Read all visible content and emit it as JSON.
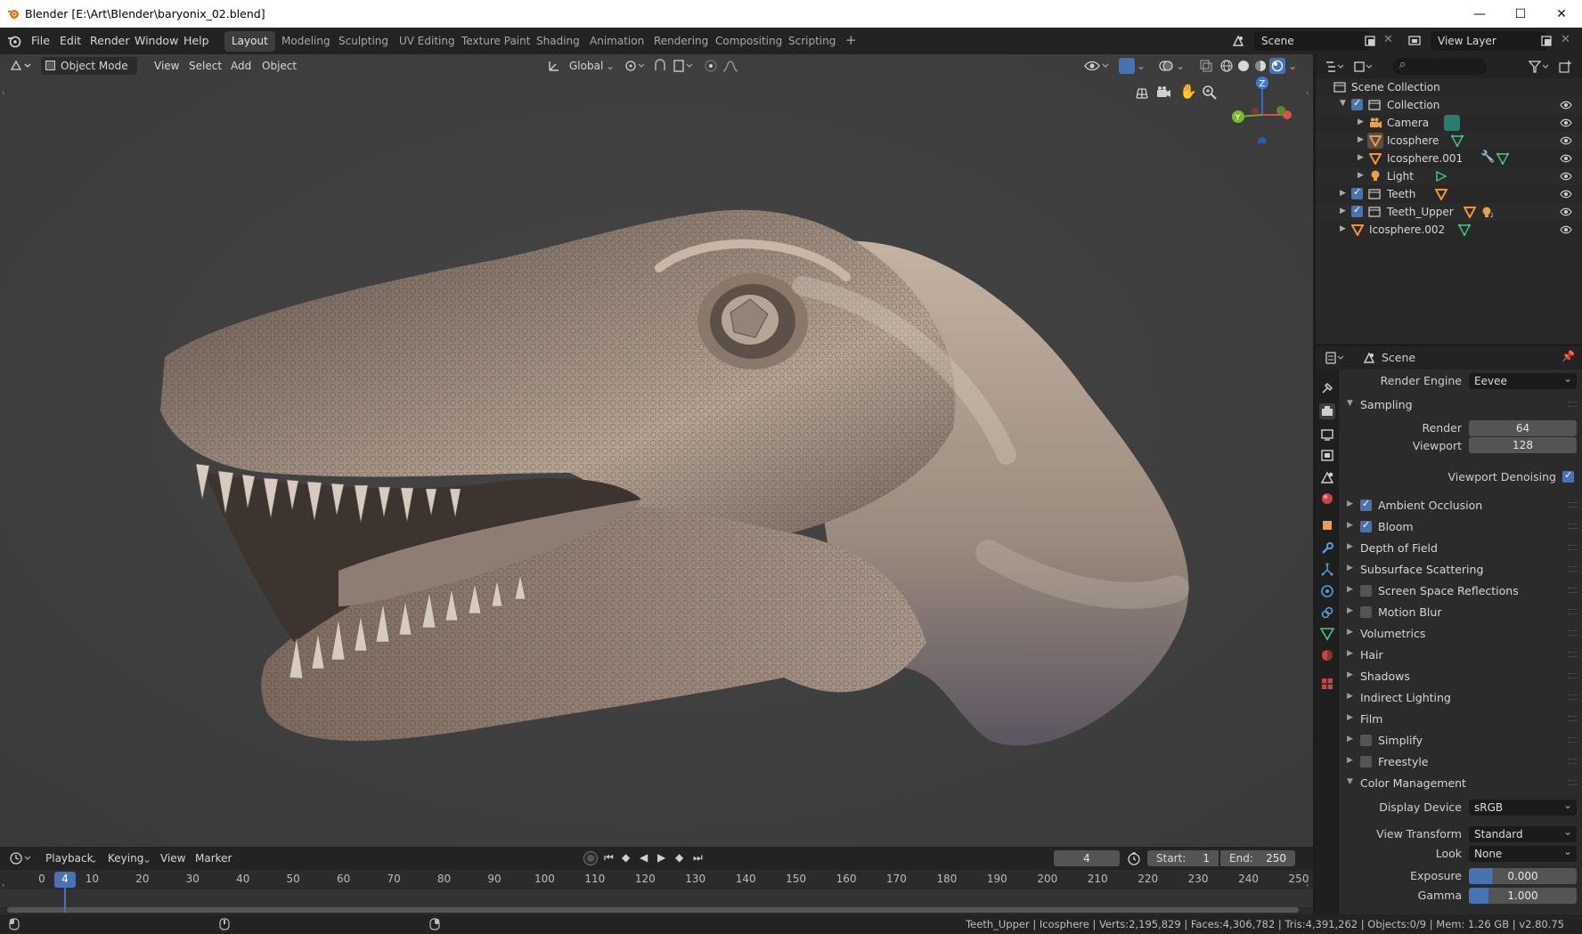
{
  "window": {
    "title": "Blender [E:\\Art\\Blender\\baryonix_02.blend]",
    "controls": {
      "minimize": "—",
      "maximize": "☐",
      "close": "✕"
    }
  },
  "menus": [
    "File",
    "Edit",
    "Render",
    "Window",
    "Help"
  ],
  "workspaces": [
    "Layout",
    "Modeling",
    "Sculpting",
    "UV Editing",
    "Texture Paint",
    "Shading",
    "Animation",
    "Rendering",
    "Compositing",
    "Scripting"
  ],
  "add_workspace": "+",
  "scene_selector": "Scene",
  "view_layer_selector": "View Layer",
  "viewport_header": {
    "mode": "Object Mode",
    "menus": [
      "View",
      "Select",
      "Add",
      "Object"
    ],
    "transform_orientation": "Global"
  },
  "outliner": {
    "root": "Scene Collection",
    "rows": [
      {
        "label": "Collection",
        "kind": "collection"
      },
      {
        "label": "Camera",
        "kind": "camera"
      },
      {
        "label": "Icosphere",
        "kind": "mesh"
      },
      {
        "label": "Icosphere.001",
        "kind": "mesh"
      },
      {
        "label": "Light",
        "kind": "light"
      },
      {
        "label": "Teeth",
        "kind": "collection"
      },
      {
        "label": "Teeth_Upper",
        "kind": "collection"
      },
      {
        "label": "Icosphere.002",
        "kind": "mesh"
      }
    ]
  },
  "properties": {
    "context": "Scene",
    "render_engine_label": "Render Engine",
    "render_engine": "Eevee",
    "sampling": {
      "title": "Sampling",
      "render_label": "Render",
      "render": "64",
      "viewport_label": "Viewport",
      "viewport": "128",
      "denoising_label": "Viewport Denoising"
    },
    "panels": [
      {
        "label": "Ambient Occlusion",
        "checkbox": true,
        "checked": true
      },
      {
        "label": "Bloom",
        "checkbox": true,
        "checked": true
      },
      {
        "label": "Depth of Field",
        "checkbox": false
      },
      {
        "label": "Subsurface Scattering",
        "checkbox": false
      },
      {
        "label": "Screen Space Reflections",
        "checkbox": true,
        "checked": false
      },
      {
        "label": "Motion Blur",
        "checkbox": true,
        "checked": false
      },
      {
        "label": "Volumetrics",
        "checkbox": false
      },
      {
        "label": "Hair",
        "checkbox": false
      },
      {
        "label": "Shadows",
        "checkbox": false
      },
      {
        "label": "Indirect Lighting",
        "checkbox": false
      },
      {
        "label": "Film",
        "checkbox": false
      },
      {
        "label": "Simplify",
        "checkbox": true,
        "checked": false
      },
      {
        "label": "Freestyle",
        "checkbox": true,
        "checked": false
      }
    ],
    "color_management": {
      "title": "Color Management",
      "display_device_label": "Display Device",
      "display_device": "sRGB",
      "view_transform_label": "View Transform",
      "view_transform": "Standard",
      "look_label": "Look",
      "look": "None",
      "exposure_label": "Exposure",
      "exposure": "0.000",
      "gamma_label": "Gamma",
      "gamma": "1.000"
    }
  },
  "timeline": {
    "menus": [
      "Playback",
      "Keying",
      "View",
      "Marker"
    ],
    "current_frame": "4",
    "start_label": "Start:",
    "start": "1",
    "end_label": "End:",
    "end": "250",
    "ruler": [
      "0",
      "10",
      "20",
      "30",
      "40",
      "50",
      "60",
      "70",
      "80",
      "90",
      "100",
      "110",
      "120",
      "130",
      "140",
      "150",
      "160",
      "170",
      "180",
      "190",
      "200",
      "210",
      "220",
      "230",
      "240",
      "250"
    ]
  },
  "status_bar": "Teeth_Upper | Icosphere | Verts:2,195,829 | Faces:4,306,782 | Tris:4,391,262 | Objects:0/9 | Mem: 1.26 GB | v2.80.75",
  "colors": {
    "accent": "#4772b3",
    "active_frame": "#4772b3",
    "background": "#3f3f3f"
  }
}
